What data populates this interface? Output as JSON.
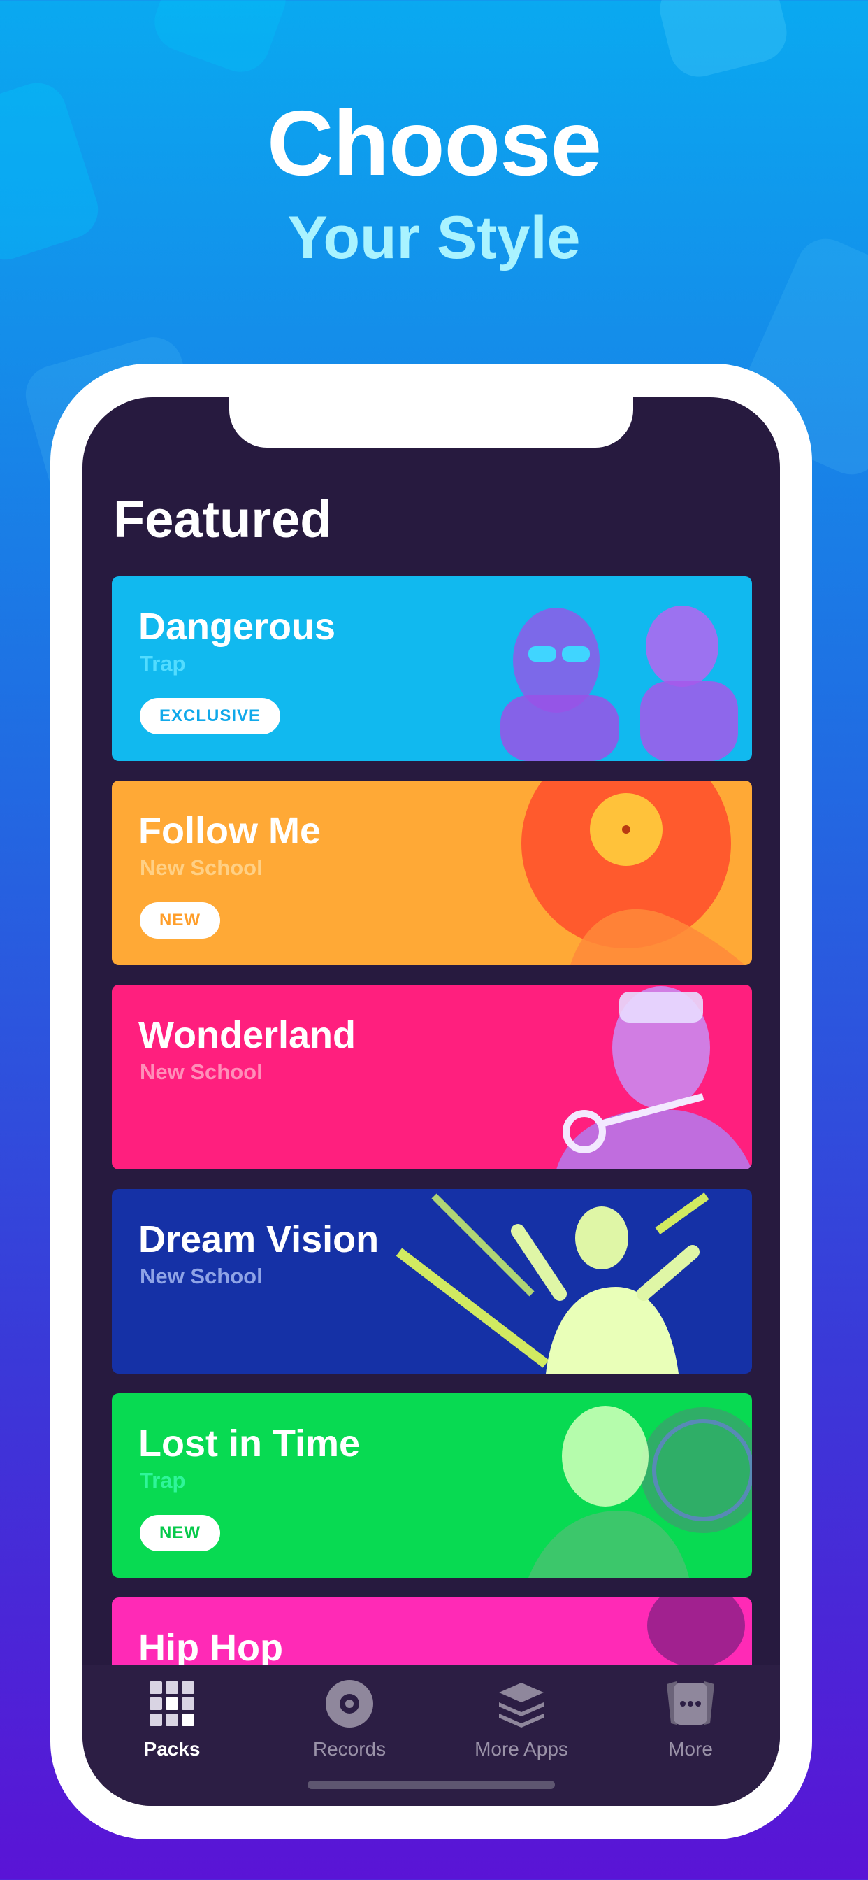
{
  "headline": "Choose",
  "subheadline": "Your Style",
  "screen": {
    "section_title": "Featured",
    "cards": [
      {
        "title": "Dangerous",
        "genre": "Trap",
        "badge": "EXCLUSIVE",
        "color": "#11b9ef",
        "genre_color": "#52dcff",
        "badge_text_color": "#11a9ea"
      },
      {
        "title": "Follow Me",
        "genre": "New School",
        "badge": "NEW",
        "color": "#ffa936",
        "genre_color": "#ffd085",
        "badge_text_color": "#ff9e2a"
      },
      {
        "title": "Wonderland",
        "genre": "New School",
        "color": "#ff1f7e",
        "genre_color": "#ff8fb9"
      },
      {
        "title": "Dream Vision",
        "genre": "New School",
        "color": "#1531a6",
        "genre_color": "#8fa4e6"
      },
      {
        "title": "Lost in Time",
        "genre": "Trap",
        "badge": "NEW",
        "color": "#08da52",
        "genre_color": "#2ff59a",
        "badge_text_color": "#07c94b"
      },
      {
        "title": "Hip Hop",
        "color": "#ff2ab6"
      }
    ]
  },
  "tabbar": {
    "tabs": [
      {
        "label": "Packs",
        "icon": "grid-icon",
        "active": true
      },
      {
        "label": "Records",
        "icon": "record-icon"
      },
      {
        "label": "More Apps",
        "icon": "layers-icon"
      },
      {
        "label": "More",
        "icon": "more-icon"
      }
    ]
  }
}
